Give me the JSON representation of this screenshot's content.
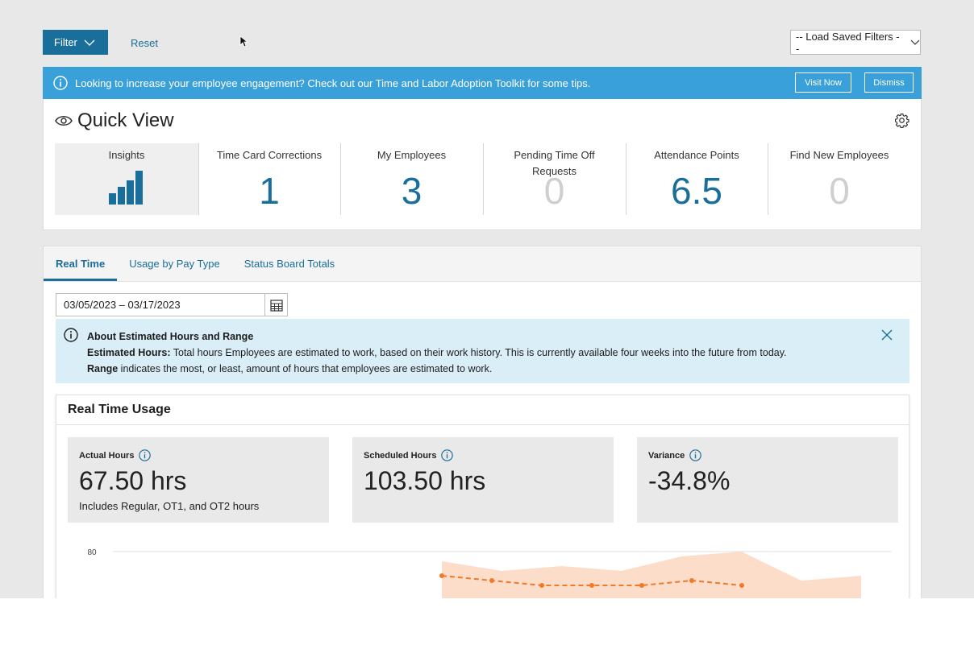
{
  "toolbar": {
    "filter_label": "Filter",
    "reset_label": "Reset",
    "saved_filters_label": "-- Load Saved Filters --"
  },
  "banner": {
    "message": "Looking to increase your employee engagement? Check out our Time and Labor Adoption Toolkit for some tips.",
    "visit_label": "Visit Now",
    "dismiss_label": "Dismiss"
  },
  "quick_view": {
    "title": "Quick View",
    "tiles": [
      {
        "label": "Insights"
      },
      {
        "label": "Time Card Corrections",
        "value": "1"
      },
      {
        "label": "My Employees",
        "value": "3"
      },
      {
        "label": "Pending Time Off Requests",
        "value": "0"
      },
      {
        "label": "Attendance Points",
        "value": "6.5"
      },
      {
        "label": "Find New Employees",
        "value": "0"
      }
    ]
  },
  "tabs": [
    {
      "label": "Real Time",
      "active": true
    },
    {
      "label": "Usage by Pay Type"
    },
    {
      "label": "Status Board Totals"
    }
  ],
  "date_range": "03/05/2023  –  03/17/2023",
  "info": {
    "title": "About Estimated Hours and Range",
    "line1_bold": "Estimated Hours:",
    "line1_text": " Total hours Employees are estimated to work, based on their work history. This is currently available four weeks into the future from today.",
    "line2_bold": "Range",
    "line2_text": " indicates the most, or least, amount of hours that employees are estimated to work."
  },
  "usage": {
    "title": "Real Time Usage",
    "metrics": [
      {
        "label": "Actual Hours",
        "value": "67.50 hrs",
        "sub": "Includes Regular, OT1, and OT2 hours"
      },
      {
        "label": "Scheduled Hours",
        "value": "103.50 hrs"
      },
      {
        "label": "Variance",
        "value": "-34.8%"
      }
    ]
  },
  "chart_data": {
    "type": "area",
    "y_tick_labels": [
      "80"
    ],
    "series": [
      {
        "values": [
          78,
          76,
          77,
          76,
          79,
          80,
          74,
          75
        ]
      },
      {
        "values": [
          75,
          74,
          73,
          73,
          73,
          74,
          73
        ]
      }
    ]
  },
  "colors": {
    "primary": "#1a6e9a",
    "banner": "#3aa0d9",
    "range_fill": "#fbd7bf",
    "estimate_line": "#ef7a2a"
  }
}
